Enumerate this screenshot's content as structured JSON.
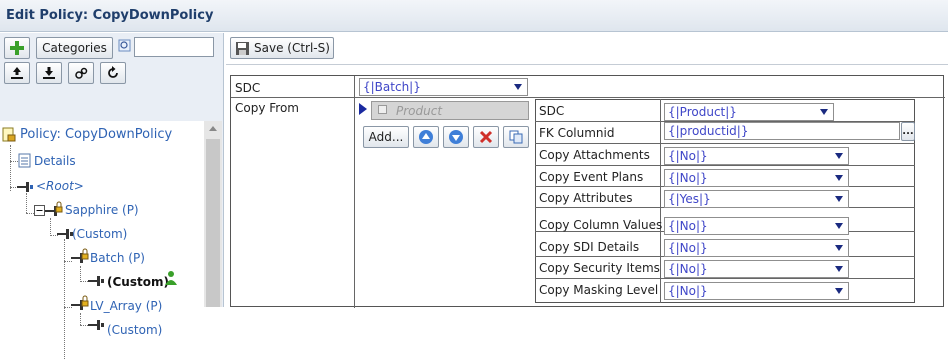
{
  "title": "Edit Policy: CopyDownPolicy",
  "left_toolbar": {
    "categories_label": "Categories",
    "search_placeholder": ""
  },
  "tree": {
    "root_title": "Policy: CopyDownPolicy",
    "details": "Details",
    "root": "<Root>",
    "sapphire": "Sapphire (P)",
    "custom1": "(Custom)",
    "batch": "Batch (P)",
    "custom_selected": "(Custom)",
    "lv_array": "LV_Array (P)",
    "custom3": "(Custom)"
  },
  "main": {
    "save_label": "Save (Ctrl-S)",
    "sdc_label": "SDC",
    "sdc_value": "{|Batch|}",
    "copy_from_label": "Copy From",
    "product_placeholder": "Product",
    "add_label": "Add...",
    "details": [
      {
        "label": "SDC",
        "value": "{|Product|}"
      },
      {
        "label": "FK Columnid",
        "value": "{|productid|}"
      },
      {
        "label": "Copy Attachments",
        "value": "{|No|}"
      },
      {
        "label": "Copy Event Plans",
        "value": "{|No|}"
      },
      {
        "label": "Copy Attributes",
        "value": "{|Yes|}"
      },
      {
        "label": "Copy Column Values",
        "value": "{|No|}"
      },
      {
        "label": "Copy SDI Details",
        "value": "{|No|}"
      },
      {
        "label": "Copy Security Items",
        "value": "{|No|}"
      },
      {
        "label": "Copy Masking Level",
        "value": "{|No|}"
      }
    ],
    "ellipsis": "..."
  },
  "colors": {
    "link": "#2f63b4",
    "value_text": "#3f46c8",
    "title_text": "#1f3e6b"
  }
}
